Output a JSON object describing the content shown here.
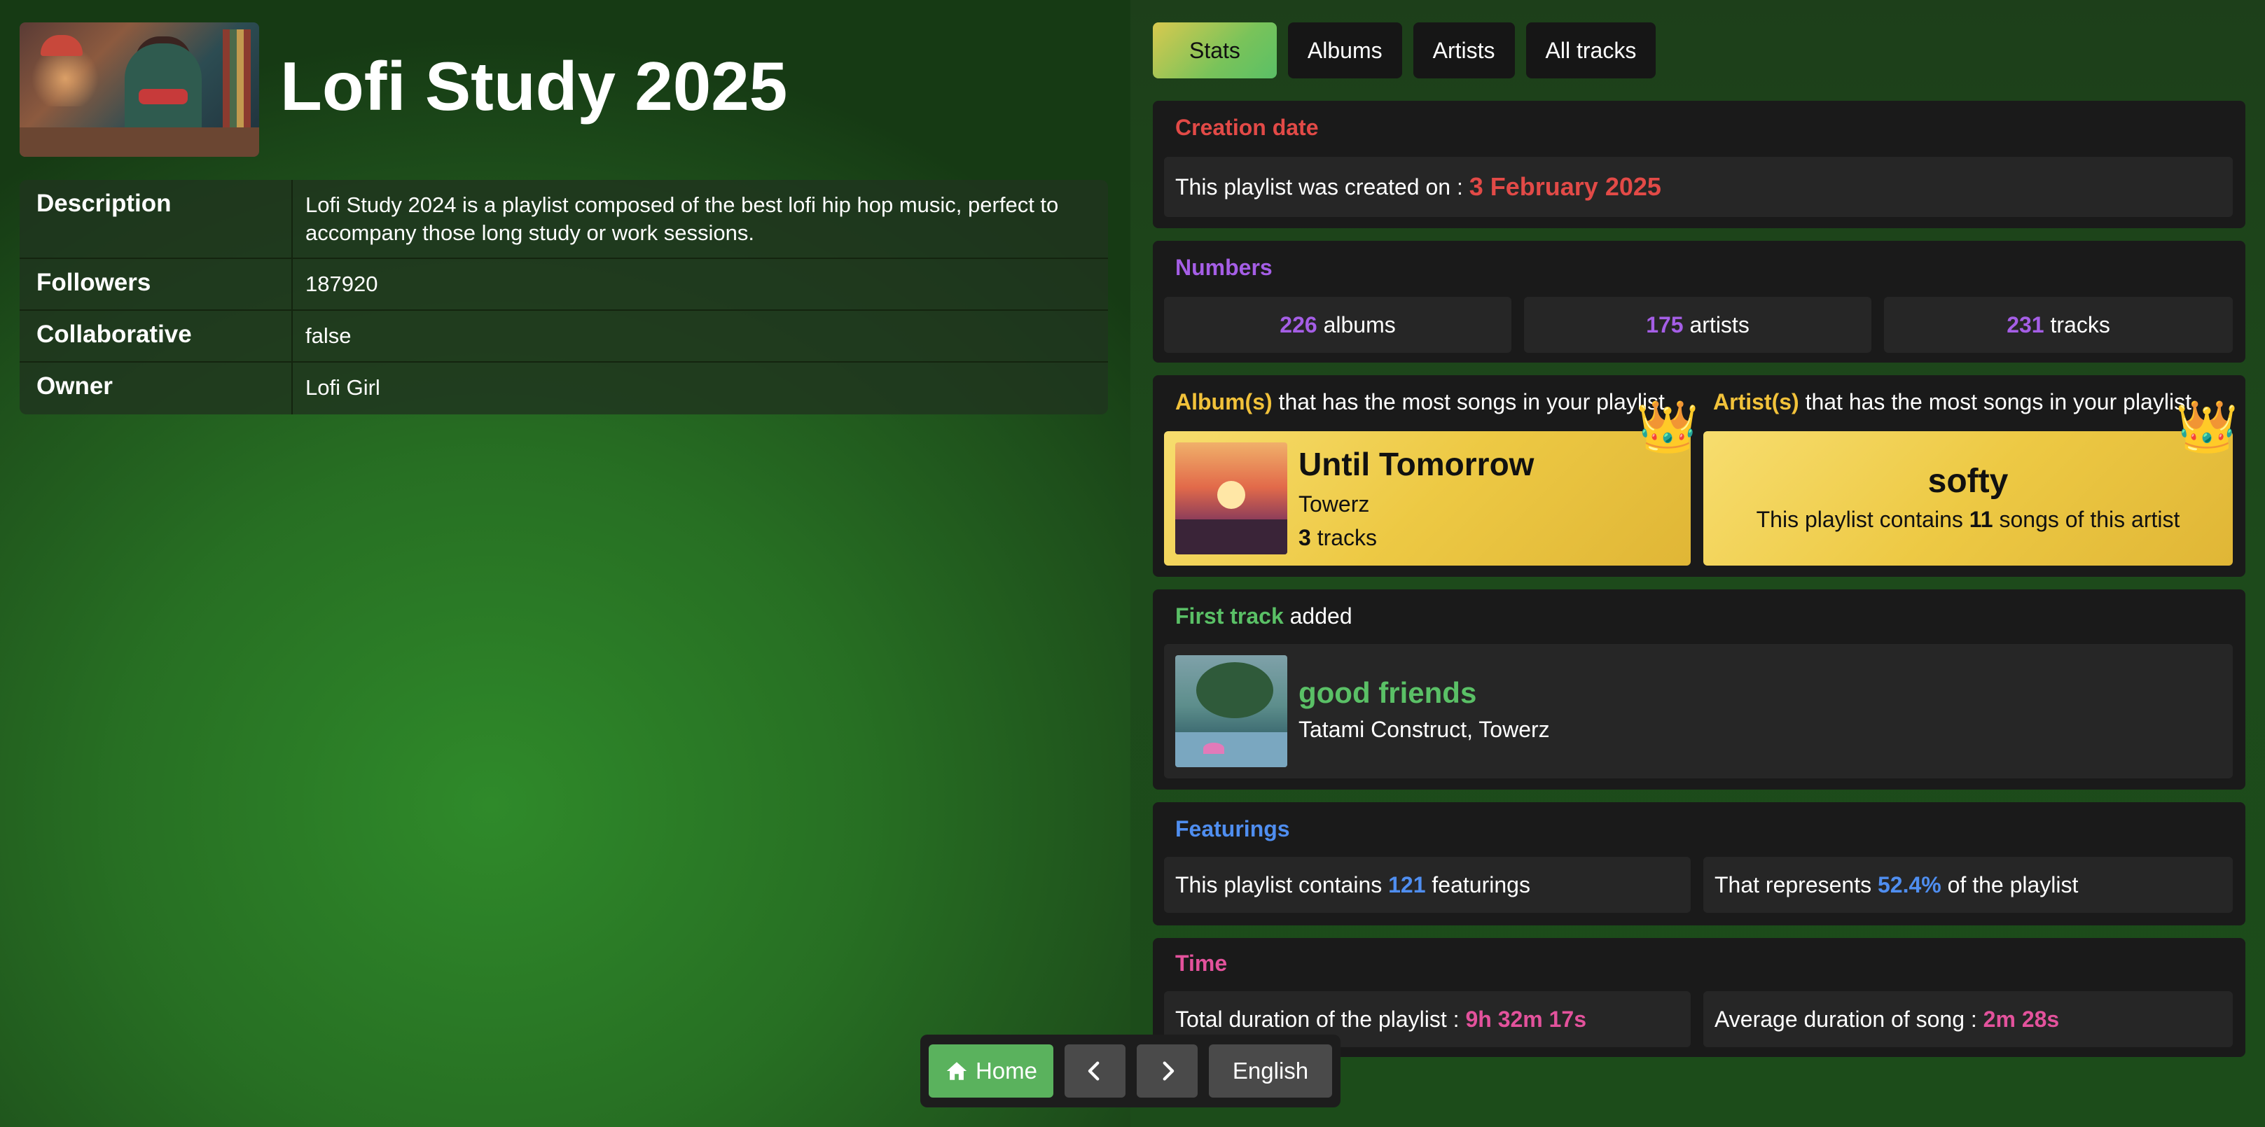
{
  "playlist": {
    "title": "Lofi Study 2025",
    "info": [
      {
        "key": "Description",
        "value": "Lofi Study 2024 is a playlist composed of the best lofi hip hop music, perfect to accompany those long study or work sessions."
      },
      {
        "key": "Followers",
        "value": "187920"
      },
      {
        "key": "Collaborative",
        "value": "false"
      },
      {
        "key": "Owner",
        "value": "Lofi Girl"
      }
    ]
  },
  "tabs": [
    "Stats",
    "Albums",
    "Artists",
    "All tracks"
  ],
  "creation": {
    "title": "Creation date",
    "prefix": "This playlist was created on :",
    "date": "3 February 2025"
  },
  "numbers": {
    "title": "Numbers",
    "albums_count": "226",
    "albums_label": "albums",
    "artists_count": "175",
    "artists_label": "artists",
    "tracks_count": "231",
    "tracks_label": "tracks"
  },
  "top": {
    "album_title_highlight": "Album(s)",
    "album_title_rest": "that has the most songs in your playlist",
    "artist_title_highlight": "Artist(s)",
    "artist_title_rest": "that has the most songs in your playlist",
    "album_name": "Until Tomorrow",
    "album_artist": "Towerz",
    "album_tracks_count": "3",
    "album_tracks_label": "tracks",
    "artist_name": "softy",
    "artist_prefix": "This playlist contains",
    "artist_count": "11",
    "artist_suffix": "songs of this artist"
  },
  "first_track": {
    "title_highlight": "First track",
    "title_rest": "added",
    "name": "good friends",
    "artists": "Tatami Construct, Towerz"
  },
  "featurings": {
    "title": "Featurings",
    "contains_prefix": "This playlist contains",
    "count": "121",
    "contains_suffix": "featurings",
    "represents_prefix": "That represents",
    "percent": "52.4%",
    "represents_suffix": "of the playlist"
  },
  "time": {
    "title": "Time",
    "total_prefix": "Total duration of the playlist :",
    "total": "9h 32m 17s",
    "avg_prefix": "Average duration of song :",
    "avg": "2m 28s"
  },
  "nav": {
    "home": "Home",
    "language": "English"
  },
  "icons": {
    "home": "home-icon",
    "prev": "chevron-left-icon",
    "next": "chevron-right-icon",
    "crown": "crown-icon"
  }
}
